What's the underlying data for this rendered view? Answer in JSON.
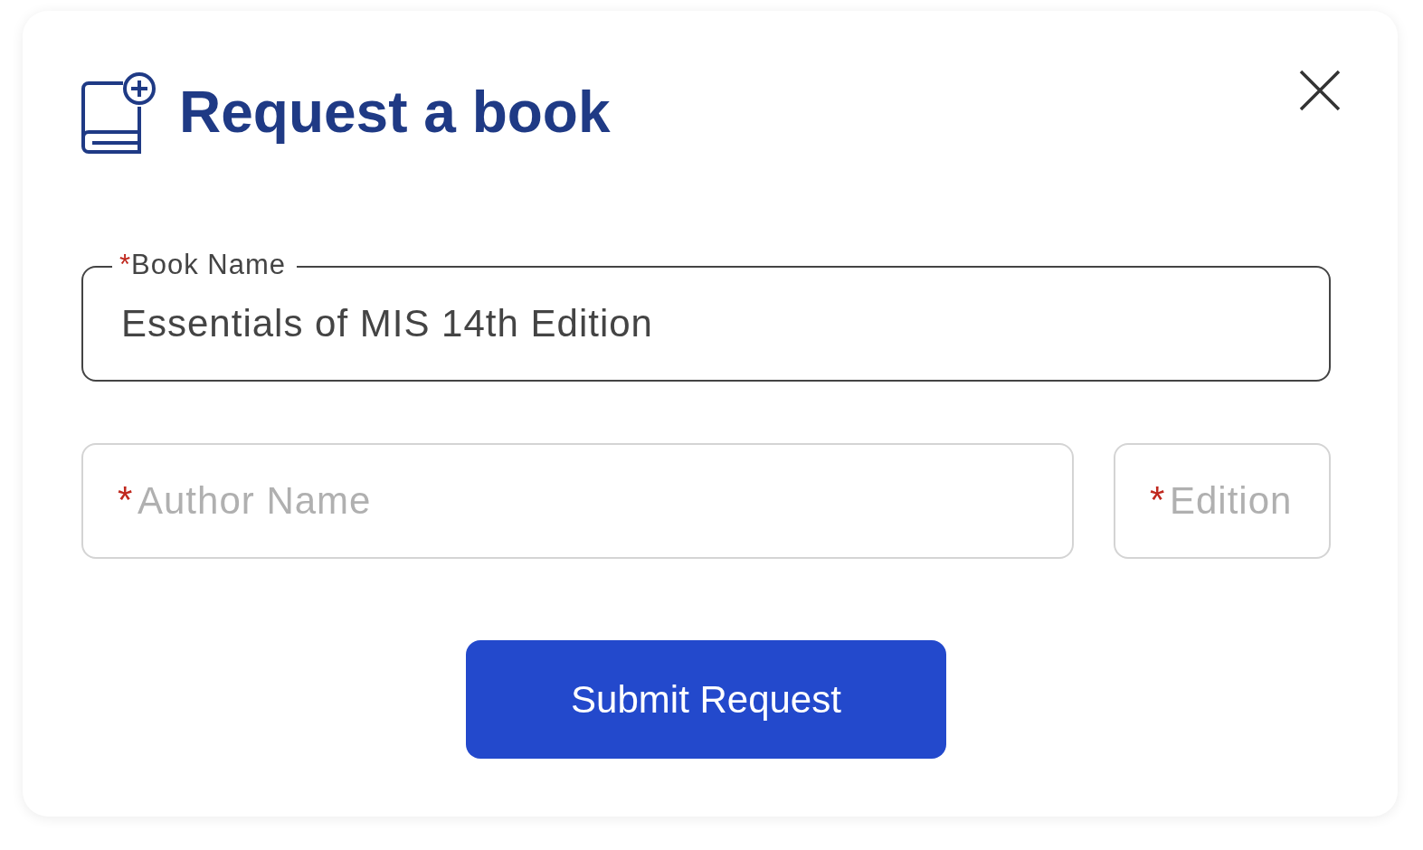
{
  "dialog": {
    "title": "Request a book"
  },
  "fields": [
    {
      "kind": "outlined",
      "label": "Book Name",
      "required_mark": "*",
      "value": "Essentials of MIS 14th Edition"
    },
    {
      "kind": "plain",
      "required_mark": "*",
      "placeholder": "Author Name"
    },
    {
      "kind": "plain",
      "required_mark": "*",
      "placeholder": "Edition"
    }
  ],
  "submit_button": {
    "label": "Submit Request"
  }
}
